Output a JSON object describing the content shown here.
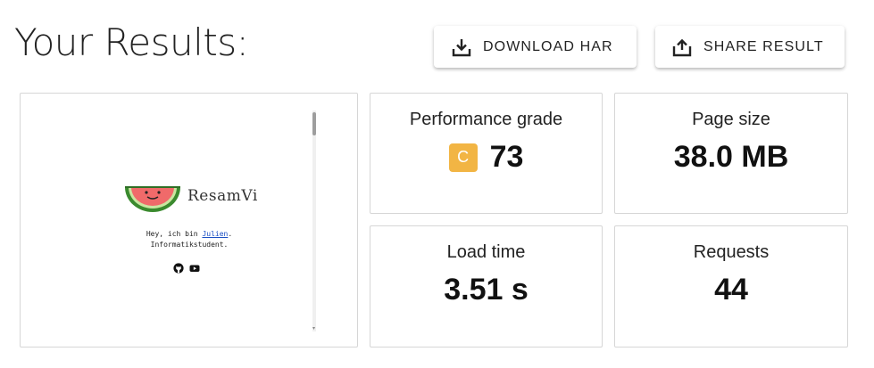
{
  "header": {
    "title": "Your Results:",
    "download_button": {
      "label": "DOWNLOAD HAR",
      "icon": "download-icon"
    },
    "share_button": {
      "label": "SHARE RESULT",
      "icon": "share-upload-icon"
    }
  },
  "preview": {
    "logo_text": "ResamVi",
    "intro_prefix": "Hey, ich bin ",
    "intro_link": "Julien",
    "intro_suffix": ".",
    "intro_line2": "Informatikstudent.",
    "social_icons": [
      "github-icon",
      "youtube-icon"
    ]
  },
  "metrics": {
    "performance": {
      "label": "Performance grade",
      "grade": "C",
      "score": "73",
      "grade_color": "#f2b544"
    },
    "page_size": {
      "label": "Page size",
      "value": "38.0 MB"
    },
    "load_time": {
      "label": "Load time",
      "value": "3.51 s"
    },
    "requests": {
      "label": "Requests",
      "value": "44"
    }
  }
}
